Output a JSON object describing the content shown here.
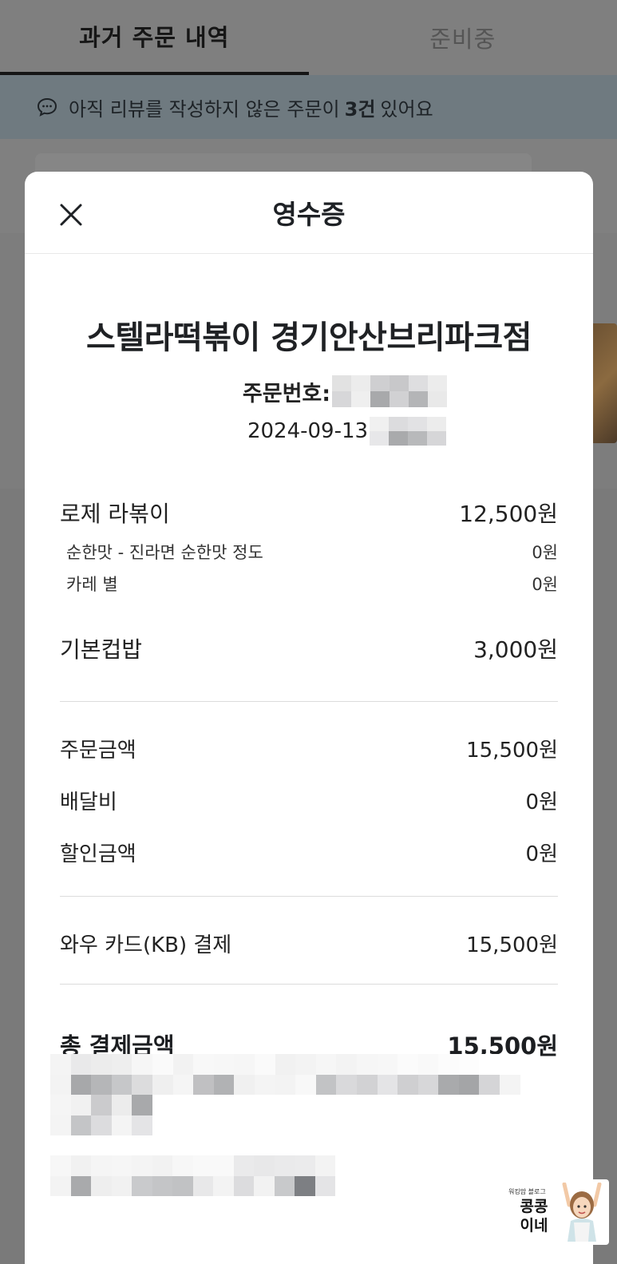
{
  "tabs": [
    {
      "label": "과거 주문 내역",
      "active": true
    },
    {
      "label": "준비중",
      "active": false
    }
  ],
  "banner": {
    "prefix": "아직 리뷰를 작성하지 않은 주문이",
    "count": "3건",
    "suffix": "있어요"
  },
  "receipt": {
    "title": "영수증",
    "store_name": "스텔라떡볶이 경기안산브리파크점",
    "order_number_label": "주문번호:",
    "order_date": "2024-09-13",
    "items": [
      {
        "name": "로제 라볶이",
        "price": "12,500원",
        "options": [
          {
            "name": "순한맛 - 진라면 순한맛 정도",
            "price": "0원"
          },
          {
            "name": "카레 별",
            "price": "0원"
          }
        ]
      },
      {
        "name": "기본컵밥",
        "price": "3,000원",
        "options": []
      }
    ],
    "summary": {
      "order_amount_label": "주문금액",
      "order_amount": "15,500원",
      "delivery_fee_label": "배달비",
      "delivery_fee": "0원",
      "discount_label": "할인금액",
      "discount": "0원"
    },
    "payment": {
      "method": "와우 카드(KB) 결제",
      "amount": "15,500원"
    },
    "total": {
      "label": "총 결제금액",
      "amount": "15,500원"
    }
  },
  "watermark": {
    "small_text": "워킹맘 블로그",
    "big_line1": "콩콩",
    "big_line2": "이네"
  },
  "colors": {
    "overlay": "#7d7d7d",
    "banner": "#6f7a80",
    "modal_bg": "#ffffff",
    "text_dark": "#1e2125",
    "divider": "#dcdcdc"
  },
  "icons": {
    "close": "close-icon",
    "banner": "chat-bubble-icon"
  }
}
